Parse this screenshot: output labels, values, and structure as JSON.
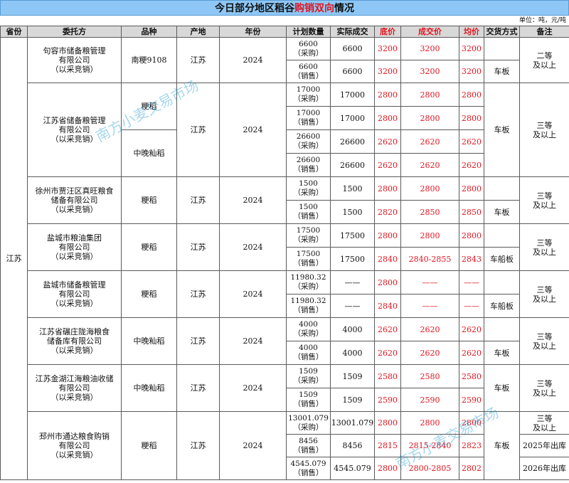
{
  "title": {
    "prefix": "今日部分地区稻谷",
    "highlight": "购销双向",
    "suffix": "情况"
  },
  "unit": "单位：吨，元/吨",
  "headers": {
    "province": "省份",
    "client": "委托方",
    "variety": "品种",
    "origin": "产地",
    "year": "年份",
    "plan": "计划数量",
    "actual": "实际成交",
    "base": "底价",
    "deal": "成交价",
    "avg": "均价",
    "delivery": "交货方式",
    "remark": "备注"
  },
  "province": "江苏",
  "watermark": "南方小麦交易市场",
  "groups": [
    {
      "client": "句容市储备粮管理\n有限公司\n（以采竞销）",
      "remark": "二等\n及以上",
      "rows": [
        {
          "variety": "南粳9108",
          "origin": "江苏",
          "year": "2024",
          "plan": "6600\n（采购）",
          "actual": "6600",
          "base": "3200",
          "deal": "3200",
          "avg": "3200",
          "delivery": ""
        },
        {
          "plan": "6600\n（销售）",
          "actual": "6600",
          "base": "3200",
          "deal": "3200",
          "avg": "3200",
          "delivery": "车板"
        }
      ]
    },
    {
      "client": "江苏省储备粮管理\n有限公司\n（以采竞销）",
      "origin": "江苏",
      "year": "2024",
      "delivery": "车板",
      "remark": "三等\n及以上",
      "varieties": [
        "粳稻",
        "中晚籼稻"
      ],
      "rows": [
        {
          "plan": "17000\n（采购）",
          "actual": "17000",
          "base": "2800",
          "deal": "2800",
          "avg": "2800"
        },
        {
          "plan": "17000\n（销售）",
          "actual": "17000",
          "base": "2800",
          "deal": "2800",
          "avg": "2800"
        },
        {
          "plan": "26600\n（采购）",
          "actual": "26600",
          "base": "2620",
          "deal": "2620",
          "avg": "2620"
        },
        {
          "plan": "26600\n（销售）",
          "actual": "26600",
          "base": "2620",
          "deal": "2620",
          "avg": "2620"
        }
      ]
    },
    {
      "client": "徐州市贾汪区真旺粮食\n储备有限公司\n（以采竞销）",
      "variety": "粳稻",
      "origin": "江苏",
      "year": "2024",
      "remark": "三等\n及以上",
      "rows": [
        {
          "plan": "1500\n（采购）",
          "actual": "1500",
          "base": "2800",
          "deal": "2800",
          "avg": "2800",
          "delivery": ""
        },
        {
          "plan": "1500\n（销售）",
          "actual": "1500",
          "base": "2820",
          "deal": "2850",
          "avg": "2850",
          "delivery": "车板"
        }
      ]
    },
    {
      "client": "盐城市粮油集团\n有限公司\n（以采竞销）",
      "variety": "粳稻",
      "origin": "江苏",
      "year": "2024",
      "remark": "三等\n及以上",
      "rows": [
        {
          "plan": "17500\n（采购）",
          "actual": "17500",
          "base": "2800",
          "deal": "2800",
          "avg": "2800",
          "delivery": ""
        },
        {
          "plan": "17500\n（销售）",
          "actual": "17500",
          "base": "2840",
          "deal": "2840-2855",
          "avg": "2843",
          "delivery": "车船板"
        }
      ]
    },
    {
      "client": "盐城市储备粮管理\n有限公司\n（以采竞销）",
      "variety": "粳稻",
      "origin": "江苏",
      "year": "2024",
      "remark": "三等\n及以上",
      "rows": [
        {
          "plan": "11980.32\n（采购）",
          "actual": "——",
          "base": "2800",
          "deal": "——",
          "avg": "——",
          "delivery": ""
        },
        {
          "plan": "11980.32\n（销售）",
          "actual": "——",
          "base": "2840",
          "deal": "——",
          "avg": "——",
          "delivery": "车船板"
        }
      ]
    },
    {
      "client": "江苏省碾庄陇海粮食\n储备库有限公司\n（以采竞销）",
      "variety": "中晚籼稻",
      "origin": "江苏",
      "year": "2024",
      "remark": "三等\n及以上",
      "rows": [
        {
          "plan": "4000\n（采购）",
          "actual": "4000",
          "base": "2620",
          "deal": "2620",
          "avg": "2620",
          "delivery": ""
        },
        {
          "plan": "4000\n（销售）",
          "actual": "4000",
          "base": "2620",
          "deal": "2620",
          "avg": "2620",
          "delivery": "车板"
        }
      ]
    },
    {
      "client": "江苏金湖江海粮油收储\n有限公司\n（以采竞销）",
      "variety": "中晚籼稻",
      "origin": "江苏",
      "year": "2024",
      "delivery": "车板",
      "remark": "三等\n及以上",
      "rows": [
        {
          "plan": "1509\n（采购）",
          "actual": "1509",
          "base": "2580",
          "deal": "2580",
          "avg": "2580"
        },
        {
          "plan": "1509\n（销售）",
          "actual": "1509",
          "base": "2590",
          "deal": "2590",
          "avg": "2590"
        }
      ]
    },
    {
      "client": "邳州市通达粮食购销\n有限公司\n（以采竞销）",
      "variety": "粳稻",
      "origin": "江苏",
      "year": "2024",
      "delivery": "车板",
      "rows": [
        {
          "plan": "13001.079\n（采购）",
          "actual": "13001.079",
          "base": "2800",
          "deal": "2800",
          "avg": "2800",
          "remark": "三等\n及以上"
        },
        {
          "plan": "8456\n（销售）",
          "actual": "8456",
          "base": "2815",
          "deal": "2815-2840",
          "avg": "2823",
          "remark": "2025年出库"
        },
        {
          "plan": "4545.079\n（销售）",
          "actual": "4545.079",
          "base": "2800",
          "deal": "2800-2805",
          "avg": "2802",
          "remark": "2026年出库"
        }
      ]
    }
  ]
}
